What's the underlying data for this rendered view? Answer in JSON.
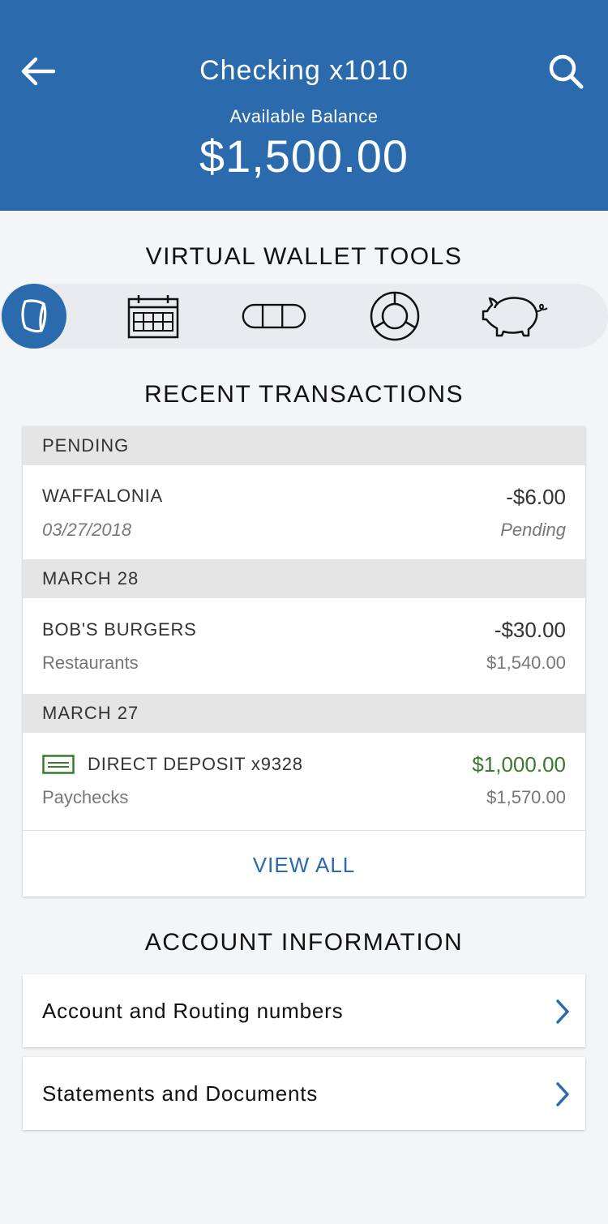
{
  "header": {
    "title": "Checking x1010",
    "balance_label": "Available Balance",
    "balance": "$1,500.00",
    "color": "#2a6aad"
  },
  "tools": {
    "title": "VIRTUAL WALLET TOOLS",
    "items": [
      {
        "icon": "wallet-icon",
        "active": true
      },
      {
        "icon": "calendar-icon",
        "active": false
      },
      {
        "icon": "money-bar-icon",
        "active": false
      },
      {
        "icon": "pie-chart-icon",
        "active": false
      },
      {
        "icon": "piggy-bank-icon",
        "active": false
      }
    ]
  },
  "transactions": {
    "title": "RECENT TRANSACTIONS",
    "groups": [
      {
        "heading": "PENDING",
        "items": [
          {
            "name": "WAFFALONIA",
            "sub": "03/27/2018",
            "amount": "-$6.00",
            "balance": "Pending"
          }
        ]
      },
      {
        "heading": "MARCH 28",
        "items": [
          {
            "name": "BOB'S BURGERS",
            "sub": "Restaurants",
            "amount": "-$30.00",
            "balance": "$1,540.00"
          }
        ]
      },
      {
        "heading": "MARCH 27",
        "items": [
          {
            "name": "DIRECT DEPOSIT x9328",
            "sub": "Paychecks",
            "amount": "$1,000.00",
            "balance": "$1,570.00",
            "icon": "check-icon"
          }
        ]
      }
    ],
    "view_all": "VIEW ALL",
    "credit_color": "#3b7a2e"
  },
  "account_info": {
    "title": "ACCOUNT INFORMATION",
    "items": [
      {
        "label": "Account and Routing numbers"
      },
      {
        "label": "Statements and Documents"
      }
    ]
  }
}
